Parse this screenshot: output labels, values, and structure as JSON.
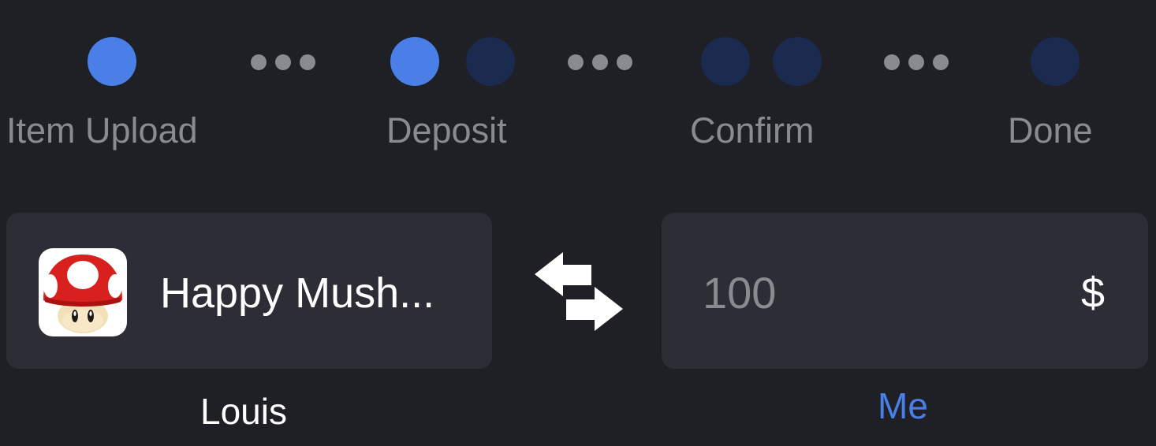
{
  "stepper": {
    "steps": [
      {
        "label": "Item Upload",
        "state": "active"
      },
      {
        "label": "Deposit",
        "state": "active"
      },
      {
        "label": "Confirm",
        "state": "inactive"
      },
      {
        "label": "Done",
        "state": "inactive"
      }
    ]
  },
  "trade": {
    "left": {
      "item_name": "Happy Mush...",
      "item_icon": "mushroom-icon",
      "owner_label": "Louis"
    },
    "swap_icon": "swap-arrows-icon",
    "right": {
      "amount": "100",
      "currency_symbol": "$",
      "owner_label": "Me"
    }
  },
  "colors": {
    "background": "#1f2026",
    "card": "#2c2d35",
    "accent": "#4a7fe8",
    "inactive_dot": "#1b2a4f",
    "muted_text": "#8a8b91"
  }
}
